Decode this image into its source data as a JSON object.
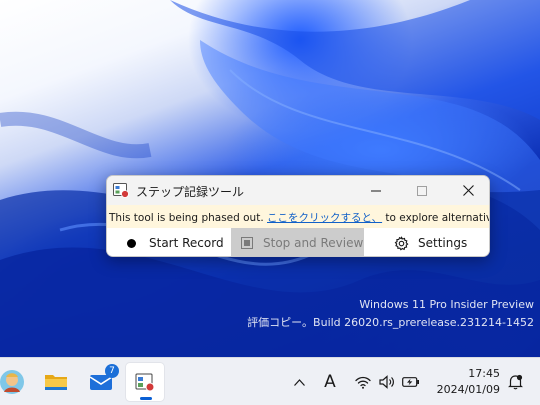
{
  "desktop": {
    "watermark": {
      "line1": "Windows 11 Pro Insider Preview",
      "line2": "評価コピー。Build 26020.rs_prerelease.231214-1452"
    }
  },
  "window": {
    "title": "ステップ記録ツール",
    "notice": {
      "prefix": "This tool is being phased out. ",
      "link": "ここをクリックすると、",
      "suffix": " to explore alternatives."
    },
    "toolbar": {
      "start_label": "Start Record",
      "stop_label": "Stop and Review",
      "settings_label": "Settings"
    }
  },
  "taskbar": {
    "mail_badge": "7",
    "tray": {
      "ime_label": "A"
    },
    "clock": {
      "time": "17:45",
      "date": "2024/01/09"
    }
  },
  "colors": {
    "accent": "#1160c8",
    "notice_bg": "#fff6dd",
    "taskbar_bg": "#eef0f5"
  }
}
